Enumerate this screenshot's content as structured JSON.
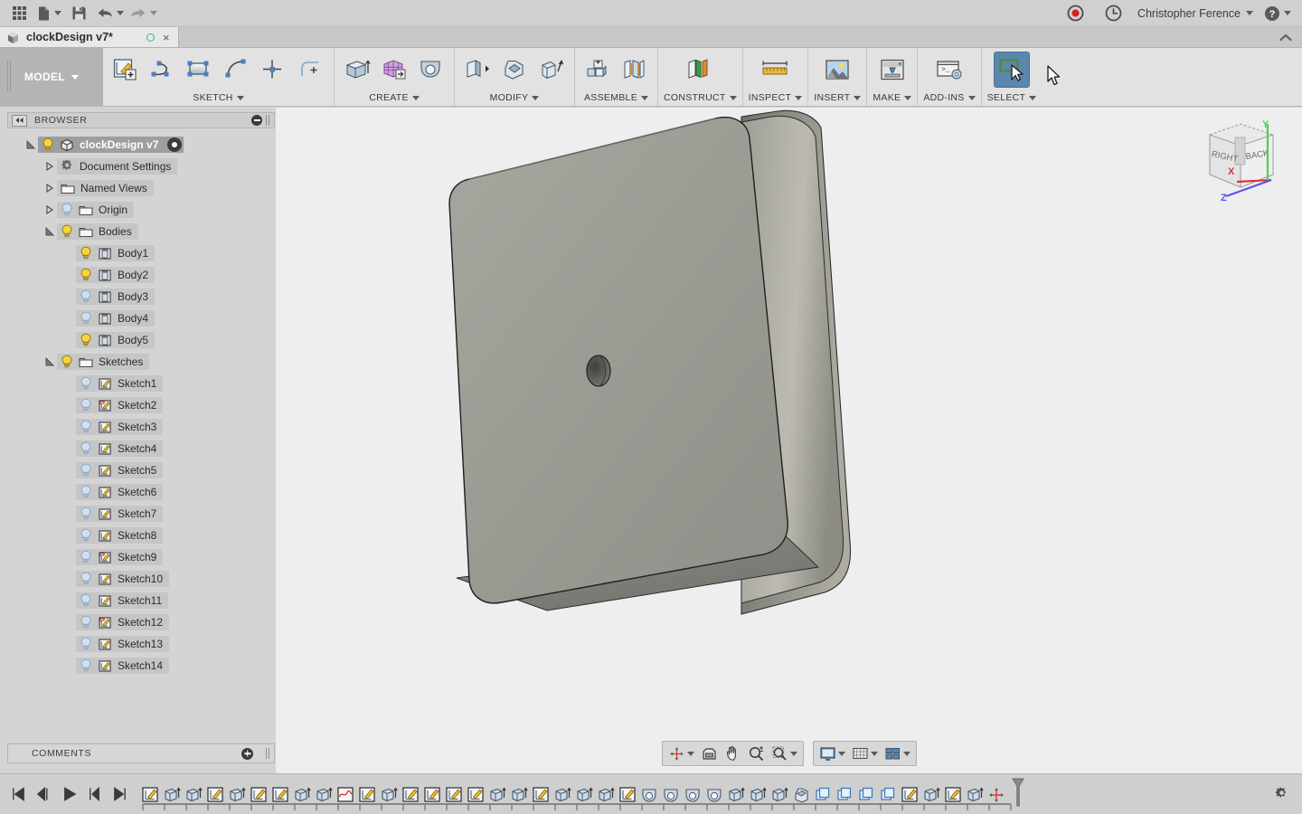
{
  "app": {
    "window_title": "clockDesign v7*",
    "accent_color": "#5b86ad",
    "viewport_bg": "#eeeeee",
    "model_color": "#9b9b94"
  },
  "quick_access": {
    "items": [
      {
        "name": "app-grid",
        "label": "Show Data Panel",
        "icon": "grid-icon",
        "caret": false
      },
      {
        "name": "new-file",
        "label": "File",
        "icon": "file-icon",
        "caret": true
      },
      {
        "name": "save",
        "label": "Save",
        "icon": "save-icon",
        "caret": false
      },
      {
        "name": "undo",
        "label": "Undo",
        "icon": "undo-icon",
        "caret": true
      },
      {
        "name": "redo",
        "label": "Redo",
        "icon": "redo-icon",
        "caret": true
      }
    ],
    "record_label": "Screencast Recording",
    "jobs_label": "Job Status",
    "user_name": "Christopher Ference",
    "help_label": "Help"
  },
  "document_tab": {
    "title": "clockDesign v7*",
    "modified_indicator": "○",
    "close_label": "×",
    "collapse_label": "Collapse Toolbar"
  },
  "workspace": {
    "label": "MODEL"
  },
  "ribbon": {
    "groups": [
      {
        "name": "sketch",
        "label": "SKETCH",
        "has_caret": true,
        "icons": [
          {
            "name": "create-sketch-icon",
            "label": "Create Sketch"
          },
          {
            "name": "line-icon",
            "label": "Line"
          },
          {
            "name": "rectangle-icon",
            "label": "Rectangle"
          },
          {
            "name": "arc-icon",
            "label": "Arc"
          },
          {
            "name": "point-icon",
            "label": "Point"
          },
          {
            "name": "fillet-sketch-icon",
            "label": "Sketch Fillet"
          }
        ]
      },
      {
        "name": "create",
        "label": "CREATE",
        "has_caret": true,
        "icons": [
          {
            "name": "extrude-icon",
            "label": "Extrude"
          },
          {
            "name": "form-icon",
            "label": "Create Form"
          },
          {
            "name": "revolve-icon",
            "label": "Revolve"
          }
        ]
      },
      {
        "name": "modify",
        "label": "MODIFY",
        "has_caret": true,
        "icons": [
          {
            "name": "press-pull-icon",
            "label": "Press Pull"
          },
          {
            "name": "fillet-icon",
            "label": "Fillet"
          },
          {
            "name": "shell-icon",
            "label": "Shell"
          }
        ]
      },
      {
        "name": "assemble",
        "label": "ASSEMBLE",
        "has_caret": true,
        "icons": [
          {
            "name": "new-component-icon",
            "label": "New Component"
          },
          {
            "name": "joint-icon",
            "label": "Joint"
          }
        ]
      },
      {
        "name": "construct",
        "label": "CONSTRUCT",
        "has_caret": true,
        "icons": [
          {
            "name": "offset-plane-icon",
            "label": "Offset Plane"
          }
        ]
      },
      {
        "name": "inspect",
        "label": "INSPECT",
        "has_caret": true,
        "icons": [
          {
            "name": "measure-icon",
            "label": "Measure"
          }
        ]
      },
      {
        "name": "insert",
        "label": "INSERT",
        "has_caret": true,
        "icons": [
          {
            "name": "insert-image-icon",
            "label": "Insert Canvas"
          }
        ]
      },
      {
        "name": "make",
        "label": "MAKE",
        "has_caret": true,
        "icons": [
          {
            "name": "3d-print-icon",
            "label": "3D Print"
          }
        ]
      },
      {
        "name": "add-ins",
        "label": "ADD-INS",
        "has_caret": true,
        "icons": [
          {
            "name": "scripts-addins-icon",
            "label": "Scripts and Add-Ins"
          }
        ]
      },
      {
        "name": "select",
        "label": "SELECT",
        "has_caret": true,
        "active": true,
        "icons": [
          {
            "name": "select-window-icon",
            "label": "Select"
          }
        ]
      }
    ]
  },
  "browser": {
    "title": "BROWSER",
    "collapse_label": "Collapse Browser",
    "tree": [
      {
        "name": "root",
        "label": "clockDesign v7",
        "indent": 0,
        "twisty": "expanded",
        "icon": "component-icon",
        "bulb": "on",
        "selected": true,
        "eye_toggle": true
      },
      {
        "name": "document-settings",
        "label": "Document Settings",
        "indent": 1,
        "twisty": "collapsed",
        "icon": "gear-icon",
        "bulb": "none"
      },
      {
        "name": "named-views",
        "label": "Named Views",
        "indent": 1,
        "twisty": "collapsed",
        "icon": "folder-icon",
        "bulb": "none"
      },
      {
        "name": "origin",
        "label": "Origin",
        "indent": 1,
        "twisty": "collapsed",
        "icon": "folder-icon",
        "bulb": "off"
      },
      {
        "name": "bodies",
        "label": "Bodies",
        "indent": 1,
        "twisty": "expanded",
        "icon": "folder-icon",
        "bulb": "on"
      },
      {
        "name": "body-1",
        "label": "Body1",
        "indent": 2,
        "twisty": "none",
        "icon": "body-icon",
        "bulb": "on"
      },
      {
        "name": "body-2",
        "label": "Body2",
        "indent": 2,
        "twisty": "none",
        "icon": "body-icon",
        "bulb": "on"
      },
      {
        "name": "body-3",
        "label": "Body3",
        "indent": 2,
        "twisty": "none",
        "icon": "body-icon",
        "bulb": "off"
      },
      {
        "name": "body-4",
        "label": "Body4",
        "indent": 2,
        "twisty": "none",
        "icon": "body-icon",
        "bulb": "off"
      },
      {
        "name": "body-5",
        "label": "Body5",
        "indent": 2,
        "twisty": "none",
        "icon": "body-icon",
        "bulb": "on"
      },
      {
        "name": "sketches",
        "label": "Sketches",
        "indent": 1,
        "twisty": "expanded",
        "icon": "folder-icon",
        "bulb": "on"
      },
      {
        "name": "sketch-1",
        "label": "Sketch1",
        "indent": 2,
        "twisty": "none",
        "icon": "sketch-icon",
        "bulb": "off"
      },
      {
        "name": "sketch-2",
        "label": "Sketch2",
        "indent": 2,
        "twisty": "none",
        "icon": "sketch-warning-icon",
        "bulb": "off"
      },
      {
        "name": "sketch-3",
        "label": "Sketch3",
        "indent": 2,
        "twisty": "none",
        "icon": "sketch-icon",
        "bulb": "off"
      },
      {
        "name": "sketch-4",
        "label": "Sketch4",
        "indent": 2,
        "twisty": "none",
        "icon": "sketch-icon",
        "bulb": "off"
      },
      {
        "name": "sketch-5",
        "label": "Sketch5",
        "indent": 2,
        "twisty": "none",
        "icon": "sketch-icon",
        "bulb": "off"
      },
      {
        "name": "sketch-6",
        "label": "Sketch6",
        "indent": 2,
        "twisty": "none",
        "icon": "sketch-icon",
        "bulb": "off"
      },
      {
        "name": "sketch-7",
        "label": "Sketch7",
        "indent": 2,
        "twisty": "none",
        "icon": "sketch-icon",
        "bulb": "off"
      },
      {
        "name": "sketch-8",
        "label": "Sketch8",
        "indent": 2,
        "twisty": "none",
        "icon": "sketch-icon",
        "bulb": "off"
      },
      {
        "name": "sketch-9",
        "label": "Sketch9",
        "indent": 2,
        "twisty": "none",
        "icon": "sketch-warning-icon",
        "bulb": "off"
      },
      {
        "name": "sketch-10",
        "label": "Sketch10",
        "indent": 2,
        "twisty": "none",
        "icon": "sketch-icon",
        "bulb": "off"
      },
      {
        "name": "sketch-11",
        "label": "Sketch11",
        "indent": 2,
        "twisty": "none",
        "icon": "sketch-icon",
        "bulb": "off"
      },
      {
        "name": "sketch-12",
        "label": "Sketch12",
        "indent": 2,
        "twisty": "none",
        "icon": "sketch-warning-icon",
        "bulb": "off"
      },
      {
        "name": "sketch-13",
        "label": "Sketch13",
        "indent": 2,
        "twisty": "none",
        "icon": "sketch-icon",
        "bulb": "off"
      },
      {
        "name": "sketch-14",
        "label": "Sketch14",
        "indent": 2,
        "twisty": "none",
        "icon": "sketch-icon",
        "bulb": "off"
      }
    ]
  },
  "comments": {
    "title": "COMMENTS",
    "add_label": "Add Comment"
  },
  "viewcube": {
    "face_left": "RIGHT",
    "face_right": "BACK",
    "axis_x": "X",
    "axis_y": "Y",
    "axis_z": "Z",
    "color_x": "#e03434",
    "color_y": "#4fd04f",
    "color_z": "#5555ee"
  },
  "navbar": {
    "groups": [
      {
        "name": "nav-tools",
        "buttons": [
          {
            "name": "orbit-icon",
            "label": "Orbit",
            "caret": true
          },
          {
            "name": "look-at-icon",
            "label": "Look At",
            "caret": false
          },
          {
            "name": "pan-icon",
            "label": "Pan",
            "caret": false
          },
          {
            "name": "zoom-icon",
            "label": "Zoom",
            "caret": false
          },
          {
            "name": "zoom-window-icon",
            "label": "Fit",
            "caret": true
          }
        ]
      },
      {
        "name": "display-tools",
        "buttons": [
          {
            "name": "display-settings-icon",
            "label": "Display Settings",
            "caret": true
          },
          {
            "name": "grid-snap-icon",
            "label": "Grid and Snaps",
            "caret": true
          },
          {
            "name": "viewports-icon",
            "label": "Viewports",
            "caret": true
          }
        ]
      }
    ]
  },
  "timeline": {
    "playback": [
      {
        "name": "timeline-go-start",
        "label": "Go to Beginning"
      },
      {
        "name": "timeline-step-back",
        "label": "Step Back"
      },
      {
        "name": "timeline-play",
        "label": "Play"
      },
      {
        "name": "timeline-step-fwd",
        "label": "Step Forward"
      },
      {
        "name": "timeline-go-end",
        "label": "Go to End"
      }
    ],
    "settings_label": "Timeline Settings",
    "end_marker_label": "Marker",
    "features": [
      {
        "name": "feature-sketch",
        "type": "sketch",
        "label": "Sketch1"
      },
      {
        "name": "feature-extrude",
        "type": "extrude",
        "label": "Extrude1"
      },
      {
        "name": "feature-extrude",
        "type": "extrude",
        "label": "Extrude2"
      },
      {
        "name": "feature-sketch",
        "type": "sketch",
        "label": "Sketch2"
      },
      {
        "name": "feature-extrude",
        "type": "extrude",
        "label": "Extrude3"
      },
      {
        "name": "feature-sketch",
        "type": "sketch",
        "label": "Sketch3"
      },
      {
        "name": "feature-sketch",
        "type": "sketch",
        "label": "Sketch4"
      },
      {
        "name": "feature-extrude",
        "type": "extrude",
        "label": "Extrude4"
      },
      {
        "name": "feature-extrude",
        "type": "extrude",
        "label": "Extrude5"
      },
      {
        "name": "feature-spline",
        "type": "spline",
        "label": "Spline1"
      },
      {
        "name": "feature-sketch",
        "type": "sketch",
        "label": "Sketch5"
      },
      {
        "name": "feature-extrude",
        "type": "extrude",
        "label": "Extrude6"
      },
      {
        "name": "feature-sketch",
        "type": "sketch",
        "label": "Sketch6"
      },
      {
        "name": "feature-sketch",
        "type": "sketch",
        "label": "Sketch7"
      },
      {
        "name": "feature-sketch",
        "type": "sketch",
        "label": "Sketch8"
      },
      {
        "name": "feature-sketch",
        "type": "sketch",
        "label": "Sketch9"
      },
      {
        "name": "feature-extrude",
        "type": "extrude",
        "label": "Extrude7"
      },
      {
        "name": "feature-extrude",
        "type": "extrude",
        "label": "Extrude8"
      },
      {
        "name": "feature-sketch",
        "type": "sketch",
        "label": "Sketch10"
      },
      {
        "name": "feature-extrude",
        "type": "extrude",
        "label": "Extrude9"
      },
      {
        "name": "feature-extrude",
        "type": "extrude",
        "label": "Extrude10"
      },
      {
        "name": "feature-extrude",
        "type": "extrude",
        "label": "Extrude11"
      },
      {
        "name": "feature-sketch",
        "type": "sketch",
        "label": "Sketch11"
      },
      {
        "name": "feature-revolve",
        "type": "revolve",
        "label": "Revolve1"
      },
      {
        "name": "feature-revolve",
        "type": "revolve",
        "label": "Revolve2"
      },
      {
        "name": "feature-revolve",
        "type": "revolve",
        "label": "Revolve3"
      },
      {
        "name": "feature-revolve",
        "type": "revolve",
        "label": "Revolve4"
      },
      {
        "name": "feature-extrude",
        "type": "extrude",
        "label": "Extrude12"
      },
      {
        "name": "feature-extrude",
        "type": "extrude",
        "label": "Extrude13"
      },
      {
        "name": "feature-extrude",
        "type": "extrude",
        "label": "Extrude14"
      },
      {
        "name": "feature-chamfer",
        "type": "chamfer",
        "label": "Chamfer1"
      },
      {
        "name": "feature-copy",
        "type": "copy",
        "label": "Copy1"
      },
      {
        "name": "feature-copy",
        "type": "copy",
        "label": "Copy2"
      },
      {
        "name": "feature-copy",
        "type": "copy",
        "label": "Copy3"
      },
      {
        "name": "feature-copy",
        "type": "copy",
        "label": "Copy4"
      },
      {
        "name": "feature-sketch",
        "type": "sketch",
        "label": "Sketch12"
      },
      {
        "name": "feature-extrude",
        "type": "extrude",
        "label": "Extrude15"
      },
      {
        "name": "feature-sketch",
        "type": "sketch",
        "label": "Sketch13"
      },
      {
        "name": "feature-extrude",
        "type": "extrude",
        "label": "Extrude16"
      },
      {
        "name": "feature-move",
        "type": "move",
        "label": "Move1"
      }
    ]
  }
}
